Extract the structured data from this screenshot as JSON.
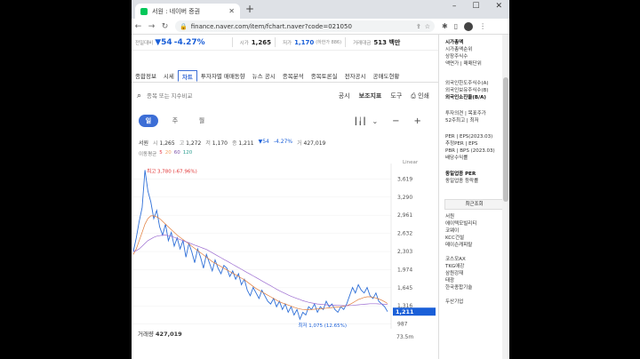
{
  "browser": {
    "tab_title": "서원 : 네이버 증권",
    "url": "finance.naver.com/item/fchart.naver?code=021050"
  },
  "header": {
    "prev_close_label": "전일대비",
    "change": "▼54",
    "change_pct": "-4.27%",
    "open_label": "시가",
    "open": "1,265",
    "low_label": "저가",
    "low": "1,170",
    "low_limit": "(하한가 886)",
    "value_label": "거래대금",
    "value": "513 백만"
  },
  "menu": [
    "종합정보",
    "시세",
    "차트",
    "투자자별 매매동향",
    "뉴스 공시",
    "종목분석",
    "종목토론실",
    "전자공시",
    "공매도현황"
  ],
  "search": {
    "placeholder": "종목 또는 지수비교",
    "tools": [
      "공시",
      "보조지표",
      "도구",
      "인쇄"
    ]
  },
  "periods": [
    "일",
    "주",
    "월"
  ],
  "quote": {
    "name": "서원",
    "open_label": "시",
    "open": "1,265",
    "high_label": "고",
    "high": "1,272",
    "low_label": "저",
    "low": "1,170",
    "close_label": "종",
    "close": "1,211",
    "change": "▼54",
    "change_pct": "-4.27%",
    "volume_label": "거",
    "volume": "427,019"
  },
  "ma": {
    "label": "이동평균",
    "values": [
      "5",
      "20",
      "60",
      "120"
    ],
    "colors": [
      "#e63946",
      "#f4a261",
      "#7b4fa8",
      "#2a9d8f"
    ]
  },
  "chart_data": {
    "type": "line",
    "scale_label": "Linear",
    "y_ticks": [
      "3,619",
      "3,290",
      "2,961",
      "2,632",
      "2,303",
      "1,974",
      "1,645",
      "1,316",
      "987"
    ],
    "ylim": [
      900,
      3900
    ],
    "current_price": "1,211",
    "max_annotation": "최고 3,780 (-67.96%)",
    "min_annotation": "최저 1,075 (12.65%)",
    "max_value": 3780,
    "min_value": 1075,
    "series": [
      {
        "values": [
          2300,
          2550,
          2850,
          3100,
          3780,
          3400,
          3200,
          2900,
          3050,
          2750,
          2600,
          2800,
          2500,
          2650,
          2400,
          2550,
          2350,
          2500,
          2200,
          2450,
          2300,
          2100,
          2350,
          2200,
          2000,
          2250,
          2100,
          1950,
          2150,
          2000,
          1900,
          2050,
          2000,
          1850,
          1950,
          1800,
          1900,
          1700,
          1800,
          1600,
          1500,
          1650,
          1550,
          1450,
          1600,
          1500,
          1400,
          1350,
          1450,
          1300,
          1400,
          1250,
          1350,
          1200,
          1300,
          1150,
          1250,
          1075,
          1200,
          1150,
          1300,
          1250,
          1350,
          1200,
          1300,
          1250,
          1400,
          1300,
          1350,
          1250,
          1200,
          1300,
          1250,
          1350,
          1500,
          1650,
          1550,
          1700,
          1600,
          1550,
          1650,
          1500,
          1450,
          1550,
          1400,
          1350,
          1300,
          1211
        ]
      },
      {
        "values": [
          2250,
          2350,
          2500,
          2650,
          2800,
          2900,
          2950,
          2950,
          2930,
          2900,
          2850,
          2800,
          2750,
          2700,
          2650,
          2600,
          2560,
          2520,
          2480,
          2440,
          2400,
          2360,
          2320,
          2280,
          2240,
          2200,
          2160,
          2120,
          2090,
          2060,
          2030,
          2000,
          1970,
          1940,
          1910,
          1880,
          1850,
          1820,
          1790,
          1750,
          1710,
          1670,
          1630,
          1600,
          1570,
          1540,
          1510,
          1480,
          1450,
          1420,
          1390,
          1370,
          1350,
          1330,
          1310,
          1290,
          1275,
          1260,
          1250,
          1245,
          1245,
          1250,
          1255,
          1260,
          1265,
          1270,
          1275,
          1280,
          1285,
          1290,
          1295,
          1300,
          1310,
          1320,
          1340,
          1370,
          1400,
          1430,
          1450,
          1470,
          1480,
          1480,
          1470,
          1460,
          1440,
          1420,
          1390,
          1360
        ]
      },
      {
        "values": [
          2300,
          2320,
          2350,
          2400,
          2450,
          2500,
          2530,
          2560,
          2580,
          2590,
          2600,
          2600,
          2590,
          2580,
          2560,
          2540,
          2520,
          2500,
          2480,
          2460,
          2440,
          2420,
          2400,
          2380,
          2360,
          2340,
          2310,
          2280,
          2250,
          2220,
          2190,
          2160,
          2130,
          2100,
          2070,
          2040,
          2010,
          1980,
          1950,
          1920,
          1890,
          1860,
          1830,
          1800,
          1770,
          1740,
          1710,
          1680,
          1650,
          1620,
          1590,
          1565,
          1540,
          1515,
          1490,
          1470,
          1450,
          1430,
          1410,
          1395,
          1380,
          1370,
          1360,
          1350,
          1345,
          1340,
          1335,
          1330,
          1328,
          1326,
          1324,
          1322,
          1320,
          1320,
          1322,
          1325,
          1330,
          1335,
          1340,
          1345,
          1350,
          1355,
          1355,
          1355,
          1352,
          1350,
          1345,
          1340
        ]
      }
    ],
    "volume_label": "거래량",
    "volume": "427,019",
    "volume_axis_label": "73.5m"
  },
  "sidebar": {
    "group1": [
      "시가총액",
      "시가총액순위",
      "상장주식수",
      "액면가 | 매매단위"
    ],
    "group2": [
      "외국인한도주식수(A)",
      "외국인보유주식수(B)",
      "외국인소진율(B/A)"
    ],
    "group3": [
      "투자의견 | 목표주가",
      "52주최고 | 최저"
    ],
    "group4": [
      "PER | EPS(2023.03)",
      "추정PER | EPS",
      "PBR | BPS (2023.03)",
      "배당수익률"
    ],
    "group5": [
      "동일업종 PER",
      "동일업종 등락률"
    ],
    "recent_header": "최근조회",
    "recent": [
      "서원",
      "에이텍모빌리티",
      "코웨이",
      "KCC건설",
      "메이슨캐피탈",
      "",
      "코스모AX",
      "TKG애강",
      "삼원강재",
      "태광",
      "한국종합기술",
      "",
      "두산기업"
    ]
  }
}
